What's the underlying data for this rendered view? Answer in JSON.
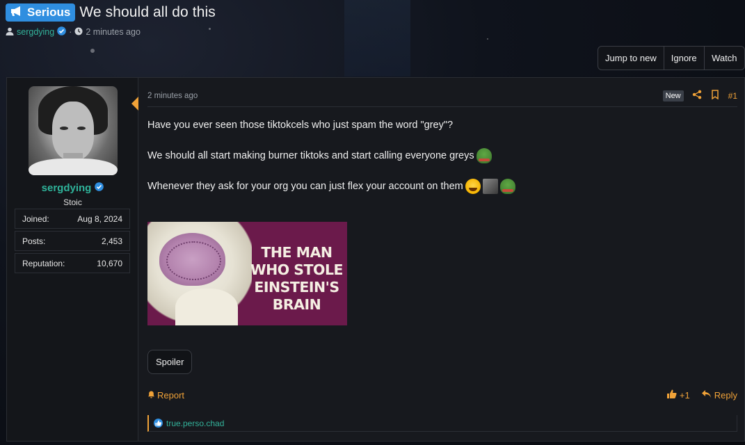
{
  "thread": {
    "prefix": "Serious",
    "title": "We should all do this",
    "author": "sergdying",
    "time": "2 minutes ago"
  },
  "thread_actions": {
    "jump_to_new": "Jump to new",
    "ignore": "Ignore",
    "watch": "Watch"
  },
  "user": {
    "name": "sergdying",
    "title": "Stoic",
    "stats": [
      {
        "label": "Joined:",
        "value": "Aug 8, 2024"
      },
      {
        "label": "Posts:",
        "value": "2,453"
      },
      {
        "label": "Reputation:",
        "value": "10,670"
      }
    ]
  },
  "post": {
    "date": "2 minutes ago",
    "new_label": "New",
    "number": "#1",
    "lines": [
      "Have you ever seen those tiktokcels who just spam the word \"grey\"?",
      "We should all start making burner tiktoks and start calling everyone greys",
      "Whenever they ask for your org you can just flex your account on them"
    ],
    "image_caption": "THE MAN\nWHO STOLE\nEINSTEIN'S\nBRAIN",
    "spoiler_label": "Spoiler"
  },
  "footer": {
    "report": "Report",
    "like_count": "+1",
    "reply": "Reply"
  },
  "reactions": {
    "user": "true.perso.chad"
  },
  "colors": {
    "accent": "#f0a238",
    "username": "#2fb39a",
    "prefix_bg": "#2f8ee0",
    "image_bg": "#6b1a4b"
  }
}
